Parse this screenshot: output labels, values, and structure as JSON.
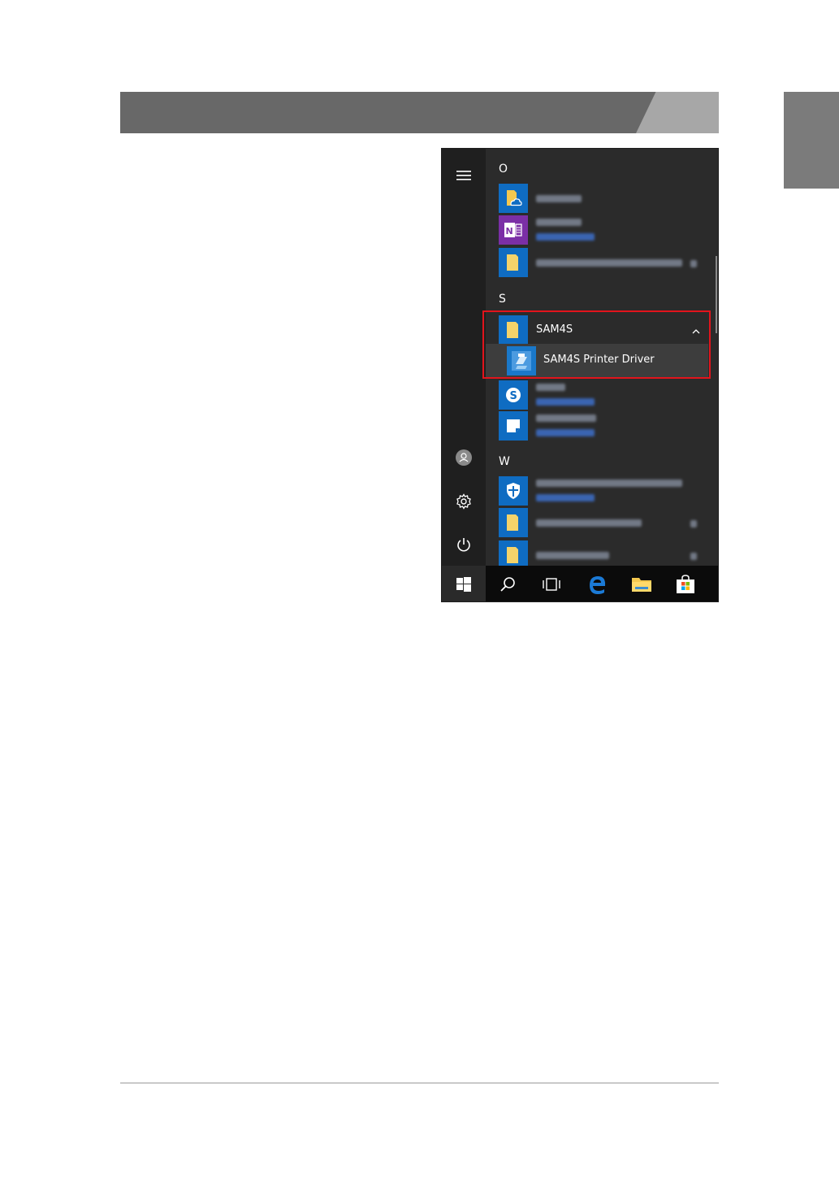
{
  "start_menu": {
    "groups": [
      {
        "letter": "O",
        "apps": [
          {
            "icon": "onedrive-folder-icon",
            "label_visible": false
          },
          {
            "icon": "onenote-icon",
            "label_visible": false
          },
          {
            "icon": "folder-icon",
            "label_visible": false
          }
        ]
      },
      {
        "letter": "S",
        "apps": [
          {
            "icon": "folder-icon",
            "label": "SAM4S",
            "expanded": true,
            "children": [
              {
                "icon": "printer-driver-icon",
                "label": "SAM4S Printer Driver"
              }
            ]
          },
          {
            "icon": "skype-icon",
            "label_visible": false
          },
          {
            "icon": "sticky-notes-icon",
            "label_visible": false
          }
        ]
      },
      {
        "letter": "W",
        "apps": [
          {
            "icon": "shield-icon",
            "label_visible": false
          },
          {
            "icon": "folder-icon",
            "label_visible": false
          },
          {
            "icon": "folder-icon",
            "label_visible": false
          }
        ]
      }
    ],
    "rail": [
      "hamburger-icon",
      "user-icon",
      "settings-icon",
      "power-icon"
    ],
    "taskbar": [
      "windows-start-icon",
      "search-icon",
      "task-view-icon",
      "edge-icon",
      "file-explorer-icon",
      "store-icon"
    ],
    "highlight_color": "#e2141c",
    "accent_color": "#0f6cc2"
  },
  "labels": {
    "letter_o": "O",
    "letter_s": "S",
    "letter_w": "W",
    "sam4s_folder": "SAM4S",
    "sam4s_driver": "SAM4S Printer Driver"
  }
}
